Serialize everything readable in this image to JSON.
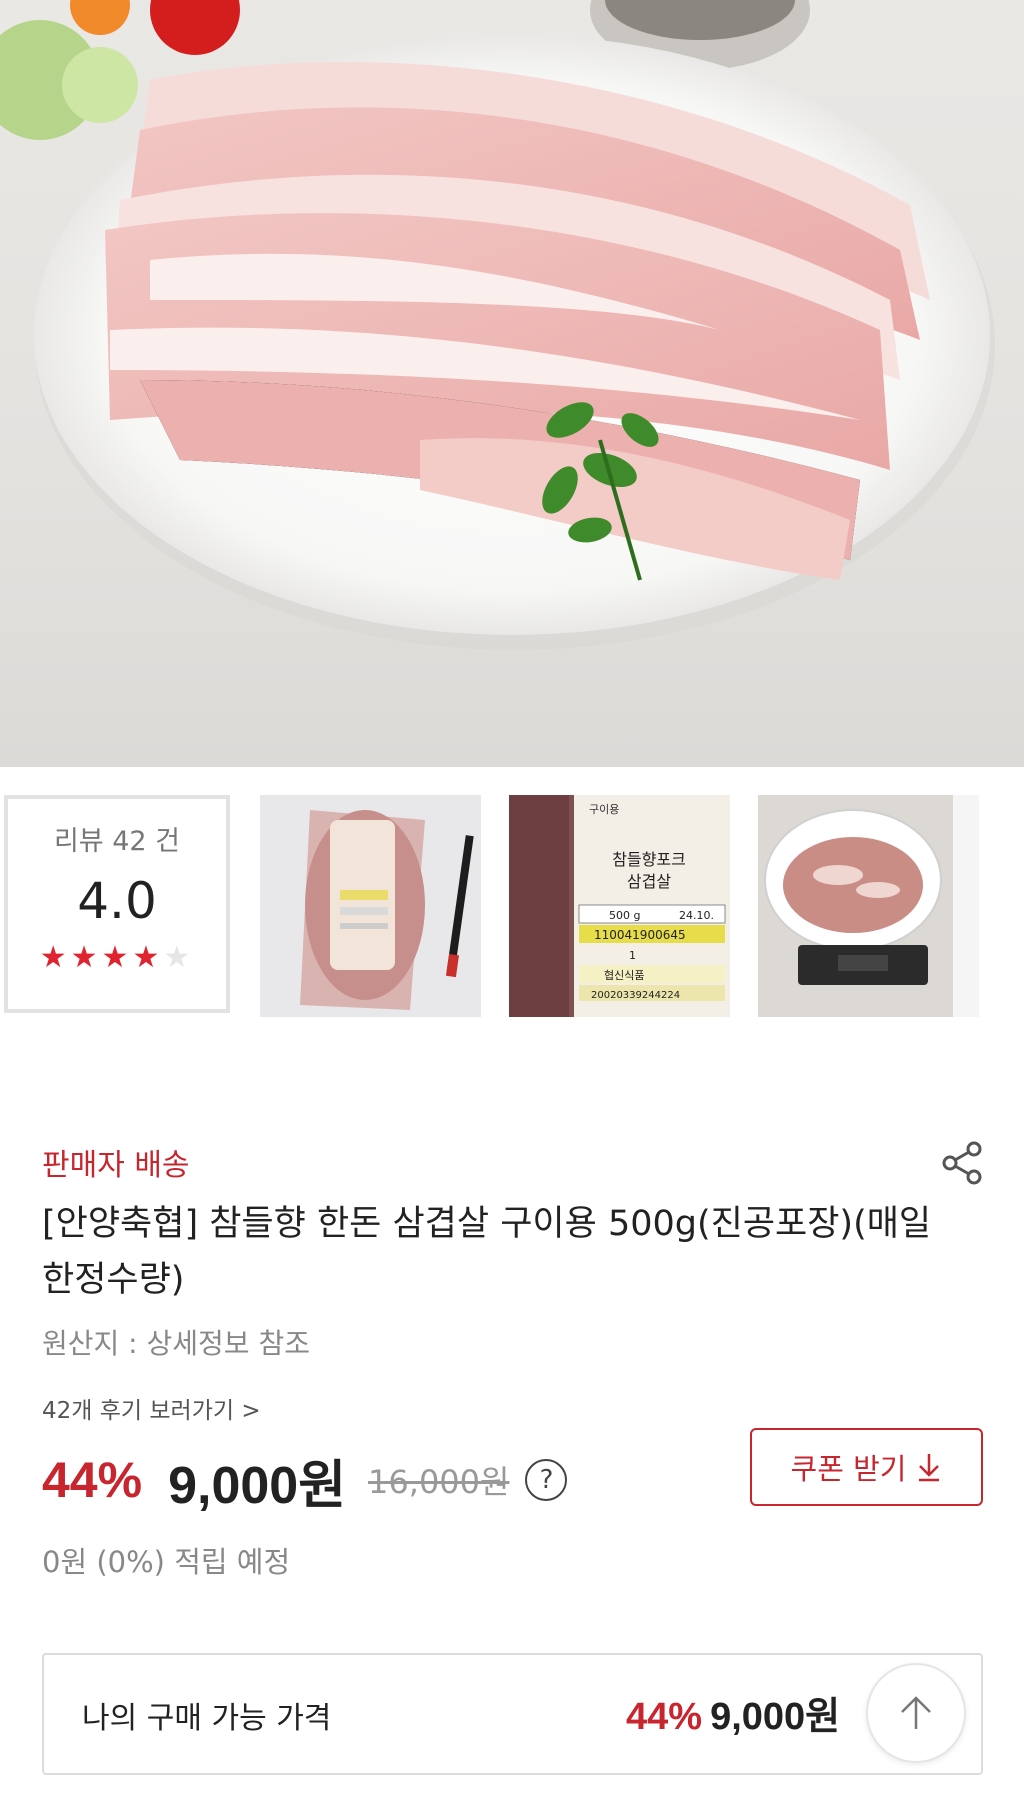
{
  "gallery": {
    "review_count_label": "리뷰 42 건",
    "rating": "4.0",
    "rating_value": 4,
    "rating_max": 5,
    "star_on": "#e0242f",
    "star_off": "#e6e6e6",
    "thumb2": {
      "label_brand": "참들향포크",
      "label_cut": "삼겹살",
      "label_use": "구이용",
      "label_weight": "500 g",
      "label_date": "24.10.",
      "label_barcode": "110041900645",
      "label_grade": "1",
      "label_company": "협신식품",
      "label_number": "20020339244224"
    }
  },
  "product": {
    "delivery_type": "판매자 배송",
    "title": "[안양축협] 참들향 한돈 삼겹살 구이용 500g(진공포장)(매일 한정수량)",
    "origin": "원산지 : 상세정보 참조",
    "review_link": "42개 후기 보러가기 >",
    "discount": "44%",
    "price": "9,000원",
    "original_price": "16,000원",
    "help_icon": "?",
    "coupon_label": "쿠폰 받기",
    "points": "0원 (0%) 적립 예정"
  },
  "my_price": {
    "label": "나의 구매 가능 가격",
    "discount": "44%",
    "price": "9,000원"
  },
  "colors": {
    "accent": "#c8262f"
  }
}
